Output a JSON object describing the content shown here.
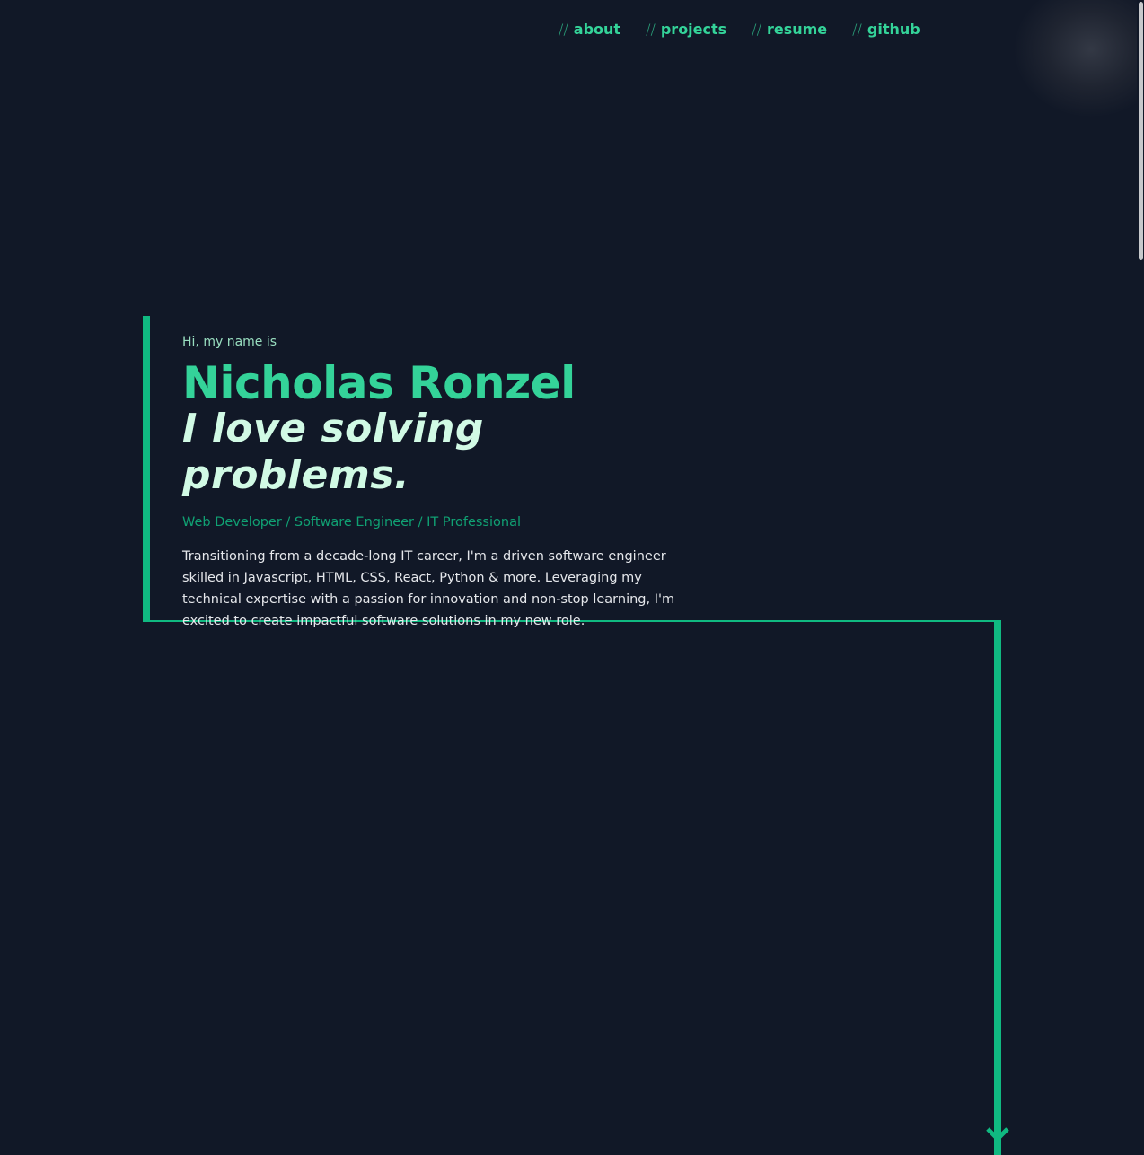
{
  "nav": {
    "separator": "//",
    "items": [
      {
        "label": "about"
      },
      {
        "label": "projects"
      },
      {
        "label": "resume"
      },
      {
        "label": "github"
      }
    ]
  },
  "hero": {
    "greeting": "Hi, my name is",
    "name": "Nicholas Ronzel",
    "tagline": "I love solving problems.",
    "roles": "Web Developer / Software Engineer / IT Professional",
    "bio": "Transitioning from a decade-long IT career, I'm a driven software engineer skilled in Javascript, HTML, CSS, React, Python & more. Leveraging my technical expertise with a passion for innovation and non-stop learning, I'm excited to create impactful software solutions in my new role."
  },
  "icons": {
    "scroll_down": "chevron-down-icon"
  },
  "colors": {
    "background": "#111827",
    "accent": "#10b981",
    "accent_light": "#34d399",
    "tagline": "#d1fae5",
    "body_text": "#e5e7eb"
  }
}
